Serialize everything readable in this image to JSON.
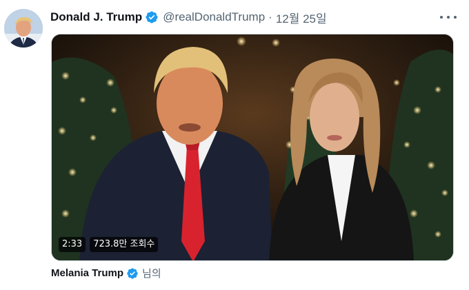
{
  "tweet": {
    "author": {
      "display_name": "Donald J. Trump",
      "handle": "@realDonaldTrump",
      "verified": true,
      "avatar_icon": "user-avatar"
    },
    "separator": "·",
    "date": "12월 25일",
    "more_icon": "more-options-icon",
    "media": {
      "type": "video",
      "duration": "2:33",
      "view_count": "723.8만 조회수"
    },
    "attribution": {
      "name": "Melania Trump",
      "verified": true,
      "suffix": "님의"
    }
  },
  "colors": {
    "verified_blue": "#1d9bf0",
    "secondary_text": "#536471",
    "primary_text": "#0f1419",
    "border": "#cfd9de"
  }
}
